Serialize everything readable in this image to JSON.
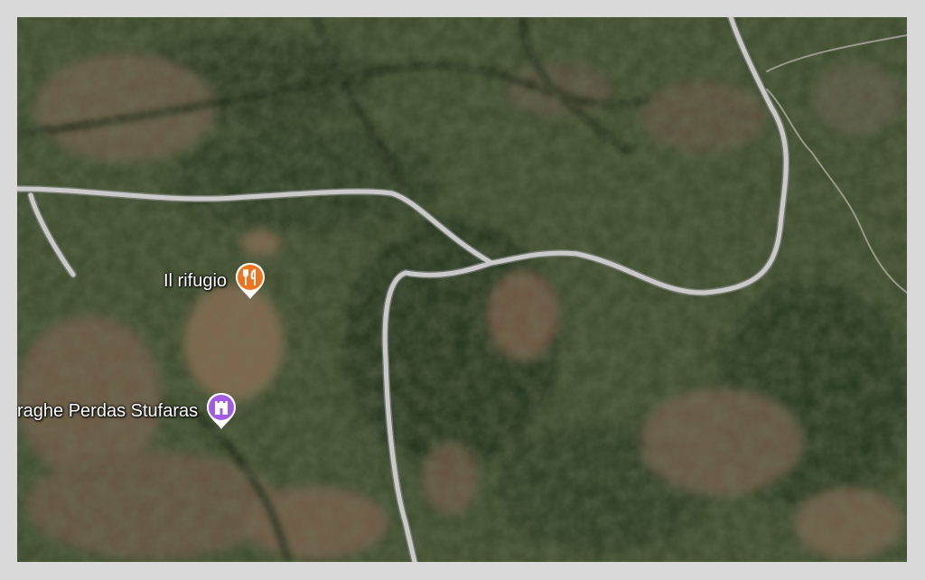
{
  "map": {
    "pois": [
      {
        "label": "Il rifugio",
        "icon": "restaurant-icon",
        "color": "#f0731e"
      },
      {
        "label": "raghe Perdas Stufaras",
        "icon": "castle-icon",
        "color": "#a35be5"
      }
    ],
    "colors": {
      "frame": "#d9d9d9",
      "road": "#c9c9c9",
      "vegetation": "#3d4a2c",
      "bare_soil": "#8a6b52"
    }
  }
}
